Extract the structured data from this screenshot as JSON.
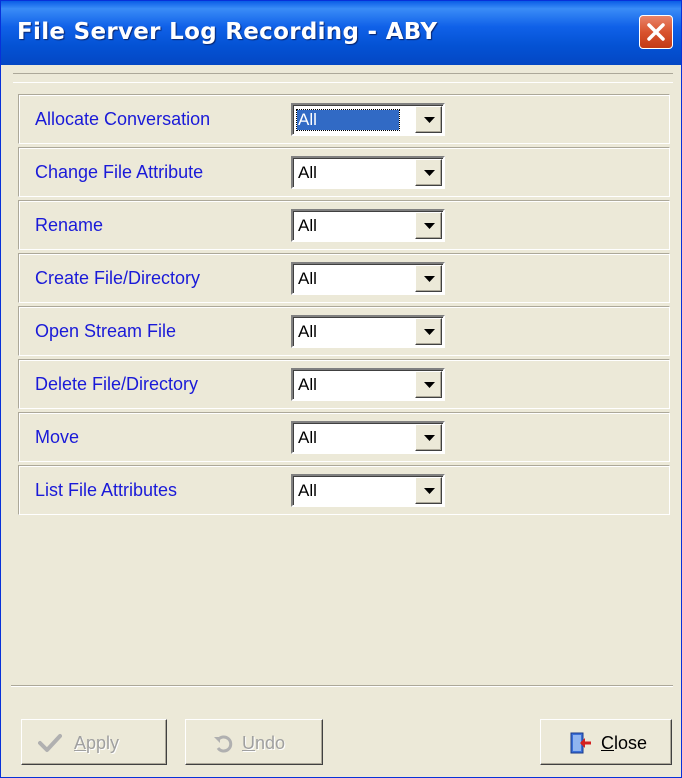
{
  "window": {
    "title": "File Server Log Recording - ABY"
  },
  "rows": [
    {
      "label": "Allocate Conversation",
      "value": "All",
      "selected": true
    },
    {
      "label": "Change File Attribute",
      "value": "All"
    },
    {
      "label": "Rename",
      "value": "All"
    },
    {
      "label": "Create File/Directory",
      "value": "All"
    },
    {
      "label": "Open Stream File",
      "value": "All"
    },
    {
      "label": "Delete File/Directory",
      "value": "All"
    },
    {
      "label": "Move",
      "value": "All"
    },
    {
      "label": "List File Attributes",
      "value": "All"
    }
  ],
  "buttons": {
    "apply": {
      "label_first": "A",
      "label_rest": "pply",
      "enabled": false,
      "icon": "checkmark-icon"
    },
    "undo": {
      "label_first": "U",
      "label_rest": "ndo",
      "enabled": false,
      "icon": "undo-icon"
    },
    "close": {
      "label_first": "C",
      "label_rest": "lose",
      "enabled": true,
      "icon": "exit-door-icon"
    }
  },
  "colors": {
    "label": "#1a1ad8",
    "titlebar": "#0452d4",
    "dialog_bg": "#ece9d8",
    "selection": "#316ac5"
  }
}
